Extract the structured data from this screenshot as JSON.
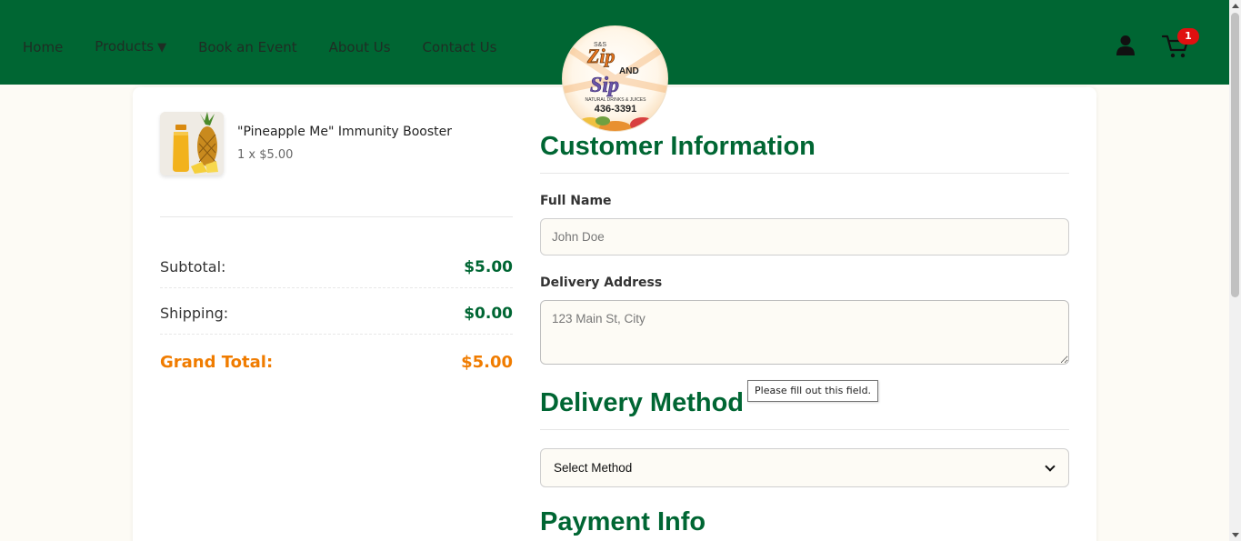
{
  "nav": {
    "items": [
      {
        "label": "Home"
      },
      {
        "label": "Products",
        "has_caret": true,
        "caret": "▼"
      },
      {
        "label": "Book an Event"
      },
      {
        "label": "About Us"
      },
      {
        "label": "Contact Us"
      }
    ]
  },
  "logo": {
    "top_text": "S&S",
    "name_1": "Zip",
    "and": "AND",
    "name_2": "Sip",
    "tagline": "NATURAL DRINKS & JUICES",
    "phone": "436-3391"
  },
  "header": {
    "cart_count": "1",
    "user_icon": "user-icon",
    "cart_icon": "cart-icon"
  },
  "order": {
    "item": {
      "name": "\"Pineapple Me\" Immunity Booster",
      "qty_price": "1 x $5.00"
    },
    "subtotal_label": "Subtotal:",
    "subtotal_value": "$5.00",
    "shipping_label": "Shipping:",
    "shipping_value": "$0.00",
    "grand_total_label": "Grand Total:",
    "grand_total_value": "$5.00"
  },
  "customer": {
    "title": "Customer Information",
    "full_name_label": "Full Name",
    "full_name_placeholder": "John Doe",
    "address_label": "Delivery Address",
    "address_placeholder": "123 Main St, City"
  },
  "delivery": {
    "title": "Delivery Method",
    "select_value": "Select Method"
  },
  "payment": {
    "title": "Payment Info"
  },
  "validation": {
    "tooltip": "Please fill out this field."
  },
  "colors": {
    "brand_green": "#006633",
    "accent_orange": "#f07c00",
    "badge_red": "#e01010"
  }
}
